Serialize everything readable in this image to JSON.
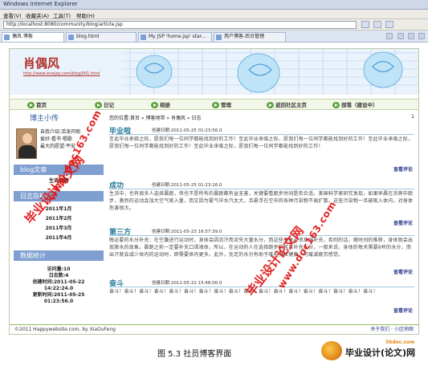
{
  "browser": {
    "window_title": "Windows Internet Explorer",
    "menu": [
      "查看(V)",
      "收藏夹(A)",
      "工具(T)",
      "帮助(H)"
    ],
    "address": "http://localhost:8080/community/blog/article.jsp",
    "tabs": [
      {
        "label": "偶风 博客",
        "active": true
      },
      {
        "label": "blog.html",
        "active": false
      },
      {
        "label": "My JSP 'home.jsp' star...",
        "active": false
      },
      {
        "label": "用户博客-后台管理",
        "active": false
      }
    ]
  },
  "site": {
    "title": "肖偶风",
    "url": "http://www.lovejsp.com/blog/001.html"
  },
  "nav": [
    {
      "label": "首页",
      "icon": "arrow-right-icon"
    },
    {
      "label": "日记",
      "icon": "arrow-right-icon"
    },
    {
      "label": "相册",
      "icon": "arrow-right-icon"
    },
    {
      "label": "管理",
      "icon": "arrow-right-icon"
    },
    {
      "label": "返回社区主页",
      "icon": "arrow-right-icon"
    },
    {
      "label": "部落（建设中）",
      "icon": "arrow-right-icon"
    }
  ],
  "sidebar": {
    "profile_heading": "博主小传",
    "profile_lines": [
      "自我介绍:活泼开朗",
      "爱好:看书 唱歌",
      "最大的愿望:平安"
    ],
    "blog_heading": "blog文章",
    "blog_items": [
      "生活随趣"
    ],
    "archive_heading": "日志存档",
    "archive_items": [
      "2011年1月",
      "2011年2月",
      "2011年3月",
      "2011年4月"
    ],
    "stats_heading": "数据统计",
    "stats_lines": [
      "访问量:10",
      "日志数:4",
      "创建时间:2011-05-22",
      "14:22:24.0",
      "更新时间:2011-05-25",
      "01:23:56.0"
    ]
  },
  "main": {
    "breadcrumb": "您的位置:首页 » 博客地带 » 肖偶风 » 日志",
    "page_number": "1",
    "read_more": "查看评论",
    "articles": [
      {
        "title": "毕业啦",
        "date": "创建日期:2011-05-25 01:23:56.0",
        "body": "至此毕业来临之际，愿我们每一位同学都能找到好的工作！至此毕业来临之际，愿我们每一位同学都能找到好的工作！至此毕业来临之际，愿我们每一位同学都能找到好的工作！至此毕业来临之际，愿我们每一位同学都能找到好的工作！"
      },
      {
        "title": "成功",
        "date": "创建日期:2011-05-25 01:23:16.0",
        "body": "生活中，也有很多人选择晨跑，但也不是所有的晨跑都有益无害，关键要看跑步时间是否合适。美国科学家研究发现，如果早晨在凉爽中跑步，激烈的运动会加大空气吸入量，而又因为雾气中水汽太大，且悬浮在空中的各种污染物不易扩散，这些污染物一旦被吸入体内，对身体危害很大。"
      },
      {
        "title": "第三方",
        "date": "创建日期:2011-05-23 16:57:39.0",
        "body": "晚必要的水分补充：在空腹进行运动时，身体会因流汗而流失大量水分，而这些液体必须及时补充，否则的话，随时间的推移，身体就会出现脱水的现象。晨跑之前一定要补充口渴液体，所以，在运动的人在选择跑步前可以补充水分，一般来说，身体的每天需要8杯的水分，而出汗就会减少体内的运动时，即需要体内更多。此外，充足的水分有助于维护身体健康，可缓减疲劳感觉。"
      },
      {
        "title": "奋斗",
        "date": "创建日期:2011-05-22 15:48:00.0",
        "body": "奋斗！奋斗！奋斗！奋斗！奋斗！奋斗！奋斗！奋斗！奋斗！奋斗！奋斗！奋斗！奋斗！奋斗！奋斗！奋斗！奋斗！奋斗！"
      }
    ]
  },
  "footer": {
    "copyright": "©2011 Happywebsite.com, by XiaOuFeng",
    "links": "关于我们 · 小区地图"
  },
  "watermarks": {
    "cn": "毕业设计论文网",
    "url": "www.doc163.com"
  },
  "caption": "图 5.3 社员博客界面",
  "brand": {
    "name": "毕业设计(论文)网",
    "domain": "56doc.com"
  }
}
